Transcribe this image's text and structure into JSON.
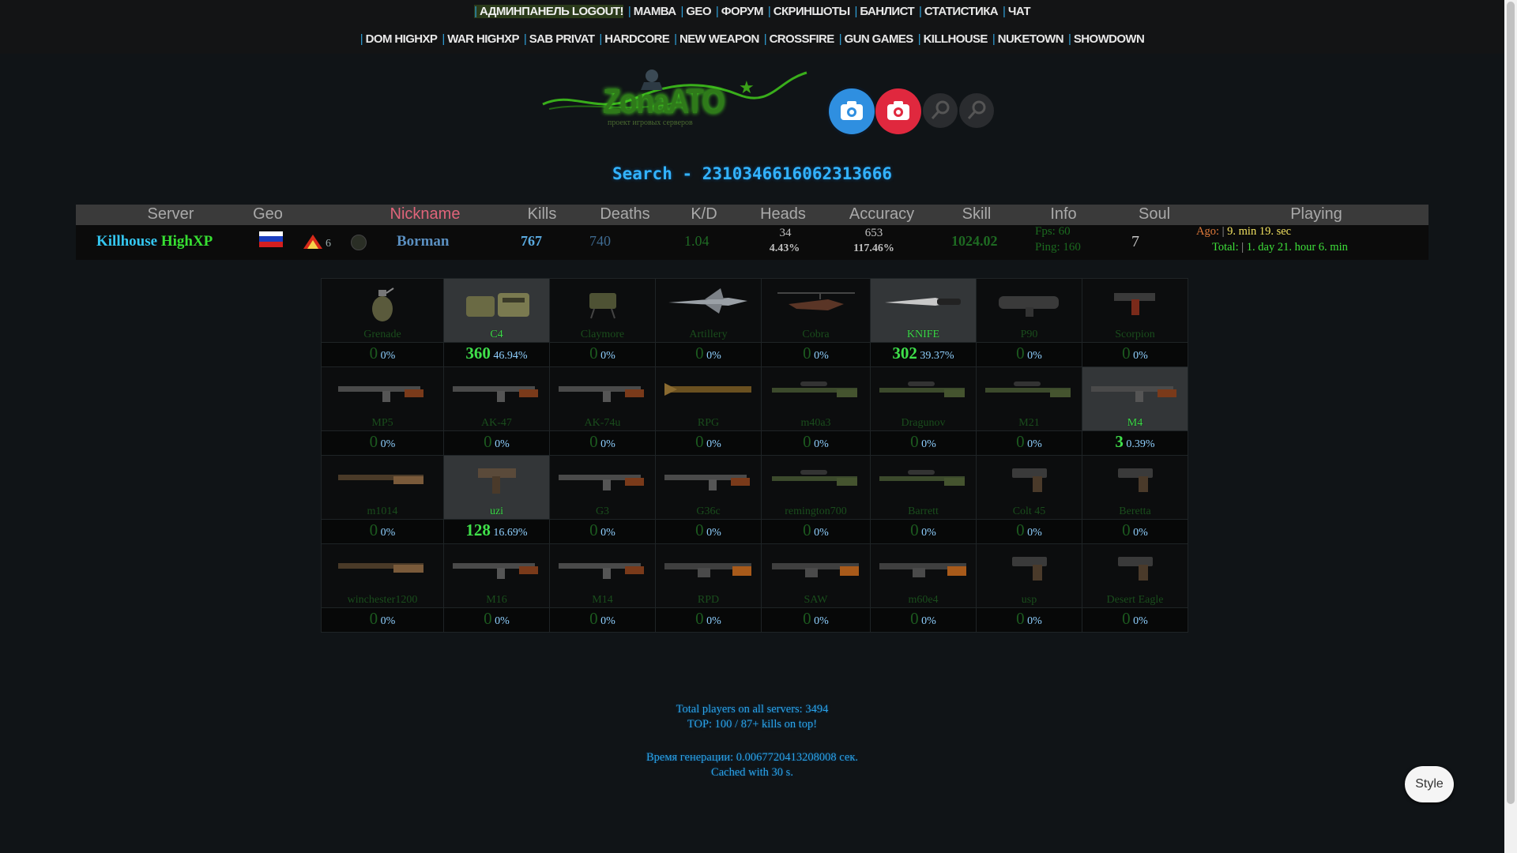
{
  "nav_top": [
    {
      "label": "АДМИНПАНЕЛЬ LOGOUT!"
    },
    {
      "label": "МАМВА"
    },
    {
      "label": "GEO"
    },
    {
      "label": "ФОРУМ"
    },
    {
      "label": "СКРИНШОТЫ"
    },
    {
      "label": "БАНЛИСТ"
    },
    {
      "label": "СТАТИСТИКА"
    },
    {
      "label": "ЧАТ"
    }
  ],
  "nav_bottom": [
    {
      "label": "DOM HIGHXP"
    },
    {
      "label": "WAR HIGHXP"
    },
    {
      "label": "SAB PRIVAT"
    },
    {
      "label": "HARDCORE"
    },
    {
      "label": "NEW WEAPON"
    },
    {
      "label": "CROSSFIRE"
    },
    {
      "label": "GUN GAMES"
    },
    {
      "label": "KILLHOUSE"
    },
    {
      "label": "NUKETOWN"
    },
    {
      "label": "SHOWDOWN"
    }
  ],
  "logo": {
    "text": "ZonaATO",
    "sub": "проект игровых серверов"
  },
  "search": {
    "text": "Search - 2310346616062313666"
  },
  "player_table": {
    "headers": {
      "server": "Server",
      "geo": "Geo",
      "nickname": "Nickname",
      "kills": "Kills",
      "deaths": "Deaths",
      "kd": "K/D",
      "heads": "Heads",
      "accuracy": "Accuracy",
      "skill": "Skill",
      "info": "Info",
      "soul": "Soul",
      "playing": "Playing"
    },
    "row": {
      "server_a": "Killhouse",
      "server_b": "HighXP",
      "rank_level": "6",
      "nickname": "Borman",
      "kills": "767",
      "deaths": "740",
      "kd": "1.04",
      "heads": "34",
      "heads_pct": "4.43%",
      "accuracy": "653",
      "accuracy_pct": "117.46%",
      "skill": "1024.02",
      "fps": "Fps: 60",
      "ping": "Ping: 160",
      "soul": "7",
      "ago_label": "Ago:",
      "ago_value": "9. min 19. sec",
      "total_label": "Total:",
      "total_value": "1. day 21. hour 6. min"
    }
  },
  "weapons": [
    [
      {
        "name": "Grenade",
        "kills": "0",
        "pct": "0%",
        "active": false,
        "icon": "grenade-icon"
      },
      {
        "name": "C4",
        "kills": "360",
        "pct": "46.94%",
        "active": true,
        "icon": "c4-icon"
      },
      {
        "name": "Claymore",
        "kills": "0",
        "pct": "0%",
        "active": false,
        "icon": "claymore-icon"
      },
      {
        "name": "Artillery",
        "kills": "0",
        "pct": "0%",
        "active": false,
        "icon": "jet-icon"
      },
      {
        "name": "Cobra",
        "kills": "0",
        "pct": "0%",
        "active": false,
        "icon": "helicopter-icon"
      },
      {
        "name": "KNIFE",
        "kills": "302",
        "pct": "39.37%",
        "active": true,
        "icon": "knife-icon"
      },
      {
        "name": "P90",
        "kills": "0",
        "pct": "0%",
        "active": false,
        "icon": "smg-icon"
      },
      {
        "name": "Scorpion",
        "kills": "0",
        "pct": "0%",
        "active": false,
        "icon": "pistol-smg-icon"
      }
    ],
    [
      {
        "name": "MP5",
        "kills": "0",
        "pct": "0%",
        "active": false,
        "icon": "rifle-icon"
      },
      {
        "name": "AK-47",
        "kills": "0",
        "pct": "0%",
        "active": false,
        "icon": "rifle-icon"
      },
      {
        "name": "AK-74u",
        "kills": "0",
        "pct": "0%",
        "active": false,
        "icon": "rifle-icon"
      },
      {
        "name": "RPG",
        "kills": "0",
        "pct": "0%",
        "active": false,
        "icon": "launcher-icon"
      },
      {
        "name": "m40a3",
        "kills": "0",
        "pct": "0%",
        "active": false,
        "icon": "sniper-icon"
      },
      {
        "name": "Dragunov",
        "kills": "0",
        "pct": "0%",
        "active": false,
        "icon": "sniper-icon"
      },
      {
        "name": "M21",
        "kills": "0",
        "pct": "0%",
        "active": false,
        "icon": "sniper-icon"
      },
      {
        "name": "M4",
        "kills": "3",
        "pct": "0.39%",
        "active": true,
        "icon": "rifle-icon"
      }
    ],
    [
      {
        "name": "m1014",
        "kills": "0",
        "pct": "0%",
        "active": false,
        "icon": "shotgun-icon"
      },
      {
        "name": "uzi",
        "kills": "128",
        "pct": "16.69%",
        "active": true,
        "icon": "uzi-icon"
      },
      {
        "name": "G3",
        "kills": "0",
        "pct": "0%",
        "active": false,
        "icon": "rifle-icon"
      },
      {
        "name": "G36c",
        "kills": "0",
        "pct": "0%",
        "active": false,
        "icon": "rifle-icon"
      },
      {
        "name": "remington700",
        "kills": "0",
        "pct": "0%",
        "active": false,
        "icon": "sniper-icon"
      },
      {
        "name": "Barrett",
        "kills": "0",
        "pct": "0%",
        "active": false,
        "icon": "sniper-icon"
      },
      {
        "name": "Colt 45",
        "kills": "0",
        "pct": "0%",
        "active": false,
        "icon": "pistol-icon"
      },
      {
        "name": "Beretta",
        "kills": "0",
        "pct": "0%",
        "active": false,
        "icon": "pistol-icon"
      }
    ],
    [
      {
        "name": "winchester1200",
        "kills": "0",
        "pct": "0%",
        "active": false,
        "icon": "shotgun-icon"
      },
      {
        "name": "M16",
        "kills": "0",
        "pct": "0%",
        "active": false,
        "icon": "rifle-icon"
      },
      {
        "name": "M14",
        "kills": "0",
        "pct": "0%",
        "active": false,
        "icon": "rifle-icon"
      },
      {
        "name": "RPD",
        "kills": "0",
        "pct": "0%",
        "active": false,
        "icon": "machinegun-icon"
      },
      {
        "name": "SAW",
        "kills": "0",
        "pct": "0%",
        "active": false,
        "icon": "machinegun-icon"
      },
      {
        "name": "m60e4",
        "kills": "0",
        "pct": "0%",
        "active": false,
        "icon": "machinegun-icon"
      },
      {
        "name": "usp",
        "kills": "0",
        "pct": "0%",
        "active": false,
        "icon": "pistol-icon"
      },
      {
        "name": "Desert Eagle",
        "kills": "0",
        "pct": "0%",
        "active": false,
        "icon": "pistol-icon"
      }
    ]
  ],
  "footer": {
    "line1": "Total players on all servers: 3494",
    "line2": "TOP: 100 / 87+ kills on top!",
    "line3": "Время генерации: 0.0067720413208008 сек.",
    "line4": "Cached with 30 s."
  },
  "style_button": "Style",
  "colors": {
    "accent": "#2ea0d8",
    "green": "#3fe04a",
    "camera_blue": "#2f8fe0",
    "camera_red": "#e0283e"
  }
}
